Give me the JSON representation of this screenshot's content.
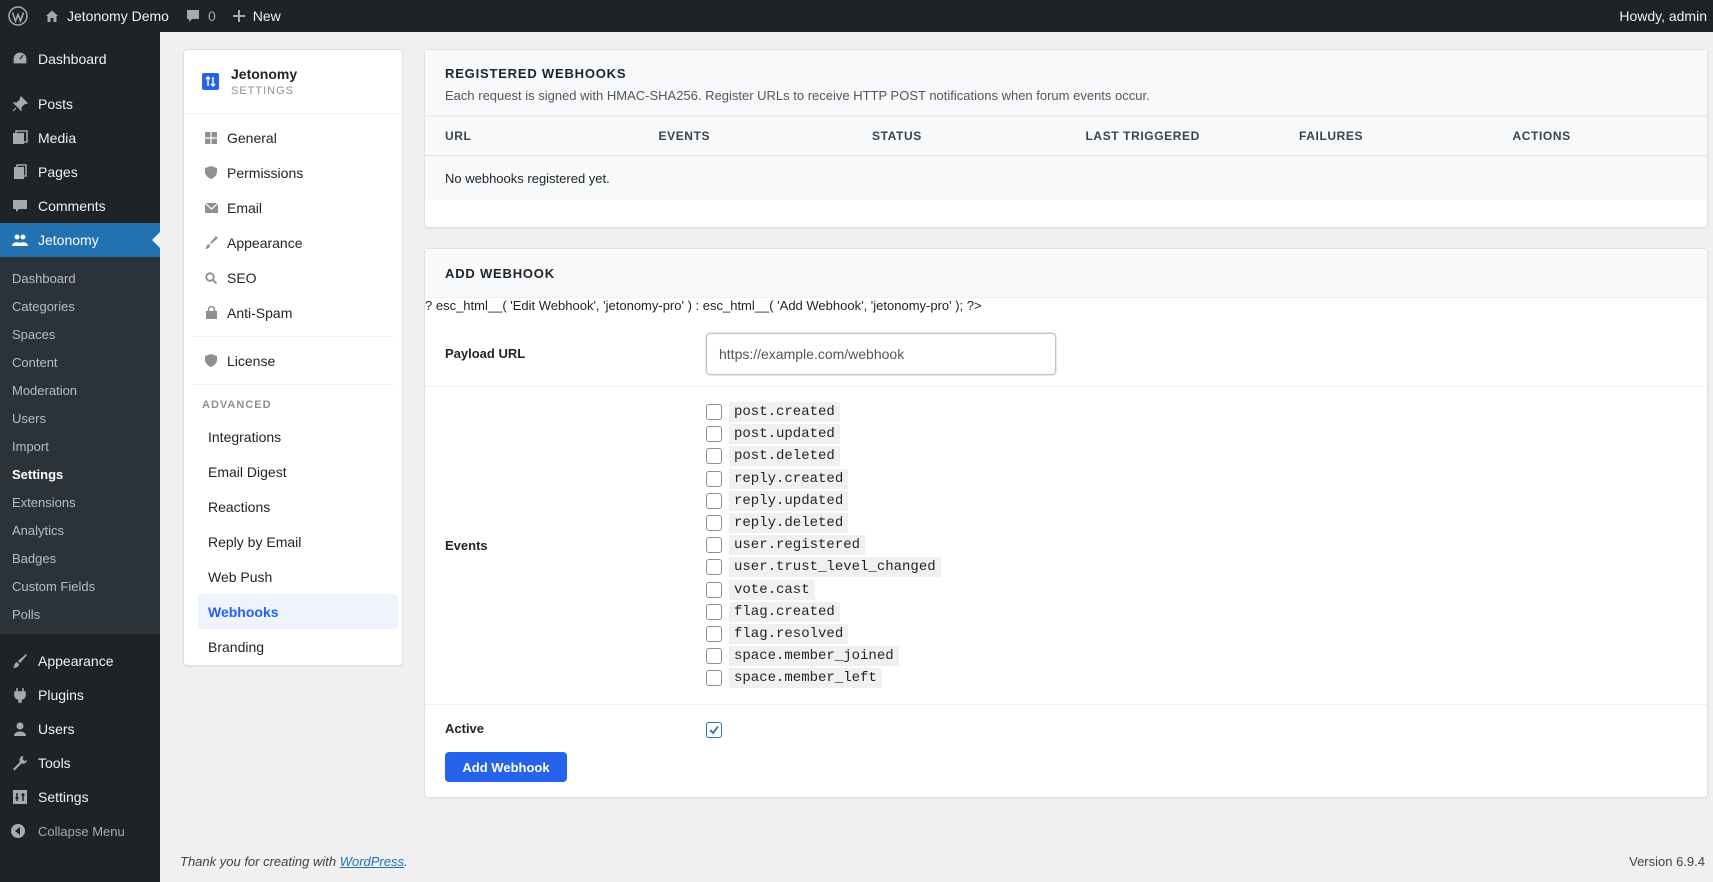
{
  "adminbar": {
    "site_name": "Jetonomy Demo",
    "comments_count": "0",
    "new_label": "New",
    "howdy": "Howdy, admin"
  },
  "menu": {
    "dashboard": "Dashboard",
    "posts": "Posts",
    "media": "Media",
    "pages": "Pages",
    "comments": "Comments",
    "jetonomy": "Jetonomy",
    "jetonomy_sub": [
      "Dashboard",
      "Categories",
      "Spaces",
      "Content",
      "Moderation",
      "Users",
      "Import",
      "Settings",
      "Extensions",
      "Analytics",
      "Badges",
      "Custom Fields",
      "Polls"
    ],
    "appearance": "Appearance",
    "plugins": "Plugins",
    "users": "Users",
    "tools": "Tools",
    "settings": "Settings",
    "collapse": "Collapse Menu"
  },
  "settings_nav": {
    "brand_title": "Jetonomy",
    "brand_subtitle": "SETTINGS",
    "items": [
      "General",
      "Permissions",
      "Email",
      "Appearance",
      "SEO",
      "Anti-Spam"
    ],
    "license": "License",
    "advanced_heading": "ADVANCED",
    "advanced_items": [
      "Integrations",
      "Email Digest",
      "Reactions",
      "Reply by Email",
      "Web Push",
      "Webhooks",
      "Branding"
    ]
  },
  "registered": {
    "title": "REGISTERED WEBHOOKS",
    "description": "Each request is signed with HMAC-SHA256. Register URLs to receive HTTP POST notifications when forum events occur.",
    "columns": [
      "URL",
      "EVENTS",
      "STATUS",
      "LAST TRIGGERED",
      "FAILURES",
      "ACTIONS"
    ],
    "empty": "No webhooks registered yet."
  },
  "add": {
    "title": "ADD WEBHOOK",
    "php_leak": "? esc_html__( 'Edit Webhook', 'jetonomy-pro' ) : esc_html__( 'Add Webhook', 'jetonomy-pro' ); ?>",
    "payload_label": "Payload URL",
    "payload_placeholder": "https://example.com/webhook",
    "events_label": "Events",
    "events": [
      "post.created",
      "post.updated",
      "post.deleted",
      "reply.created",
      "reply.updated",
      "reply.deleted",
      "user.registered",
      "user.trust_level_changed",
      "vote.cast",
      "flag.created",
      "flag.resolved",
      "space.member_joined",
      "space.member_left"
    ],
    "active_label": "Active",
    "submit": "Add Webhook"
  },
  "footer": {
    "thanks_prefix": "Thank you for creating with ",
    "thanks_link": "WordPress",
    "thanks_suffix": ".",
    "version": "Version 6.9.4"
  },
  "colors": {
    "accent": "#2563eb",
    "wp_blue": "#2271b1",
    "admin_dark": "#1d2327"
  }
}
